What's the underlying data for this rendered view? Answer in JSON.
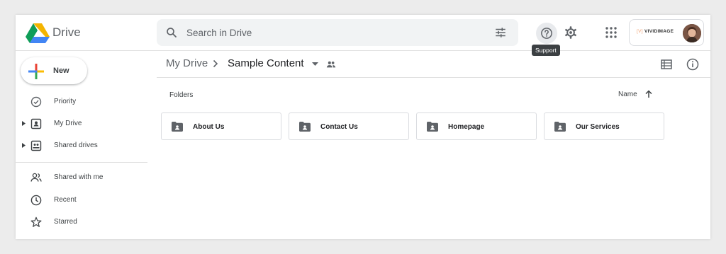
{
  "app": {
    "name": "Drive"
  },
  "search": {
    "placeholder": "Search in Drive"
  },
  "header": {
    "support_tooltip": "Support",
    "account_brand_prefix": "[V]",
    "account_brand_name": "VIVIDIMAGE"
  },
  "sidebar": {
    "new_label": "New",
    "items": [
      {
        "label": "Priority",
        "icon": "priority-icon",
        "expandable": false
      },
      {
        "label": "My Drive",
        "icon": "my-drive-icon",
        "expandable": true
      },
      {
        "label": "Shared drives",
        "icon": "shared-drives-icon",
        "expandable": true
      },
      {
        "label": "Shared with me",
        "icon": "shared-with-me-icon",
        "expandable": false
      },
      {
        "label": "Recent",
        "icon": "clock-icon",
        "expandable": false
      },
      {
        "label": "Starred",
        "icon": "star-icon",
        "expandable": false
      }
    ]
  },
  "breadcrumb": {
    "root": "My Drive",
    "current": "Sample Content"
  },
  "content": {
    "section_title": "Folders",
    "sort_label": "Name",
    "folders": [
      {
        "name": "About Us"
      },
      {
        "name": "Contact Us"
      },
      {
        "name": "Homepage"
      },
      {
        "name": "Our Services"
      }
    ]
  },
  "colors": {
    "drive_green": "#0f9d58",
    "drive_yellow": "#f4b400",
    "drive_blue": "#4285f4",
    "plus_red": "#ea4335",
    "text": "#3c4043",
    "search_bg": "#f1f3f4"
  }
}
